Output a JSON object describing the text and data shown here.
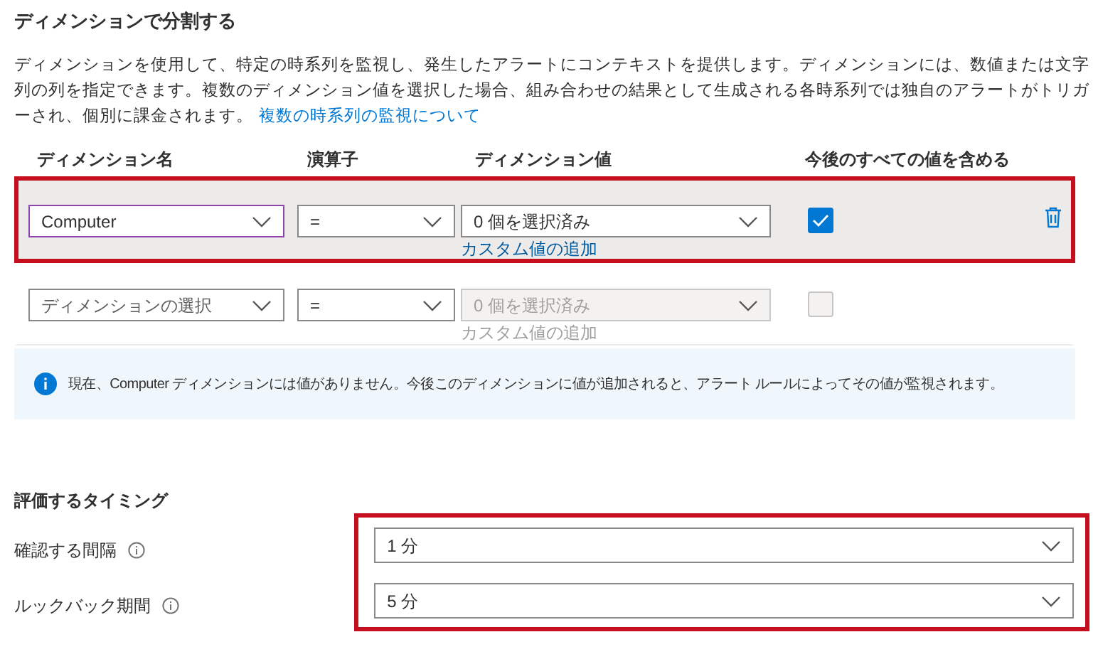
{
  "section_title": "ディメンションで分割する",
  "description": "ディメンションを使用して、特定の時系列を監視し、発生したアラートにコンテキストを提供します。ディメンションには、数値または文字列の列を指定できます。複数のディメンション値を選択した場合、組み合わせの結果として生成される各時系列では独自のアラートがトリガーされ、個別に課金されます。",
  "description_link": "複数の時系列の監視について",
  "columns": [
    "ディメンション名",
    "演算子",
    "ディメンション値",
    "今後のすべての値を含める"
  ],
  "rows": [
    {
      "name": "Computer",
      "name_is_placeholder": false,
      "focused": true,
      "operator": "=",
      "values": "0 個を選択済み",
      "values_disabled": false,
      "custom_link": "カスタム値の追加",
      "include_future": true,
      "highlighted": true,
      "deletable": true
    },
    {
      "name": "ディメンションの選択",
      "name_is_placeholder": true,
      "focused": false,
      "operator": "=",
      "values": "0 個を選択済み",
      "values_disabled": true,
      "custom_link": "カスタム値の追加",
      "include_future": false,
      "highlighted": false,
      "deletable": false
    }
  ],
  "info": "現在、Computer ディメンションには値がありません。今後このディメンションに値が追加されると、アラート ルールによってその値が監視されます。",
  "timing": {
    "title": "評価するタイミング",
    "highlighted": true,
    "fields": [
      {
        "label": "確認する間隔",
        "value": "1 分"
      },
      {
        "label": "ルックバック期間",
        "value": "5 分"
      }
    ]
  }
}
